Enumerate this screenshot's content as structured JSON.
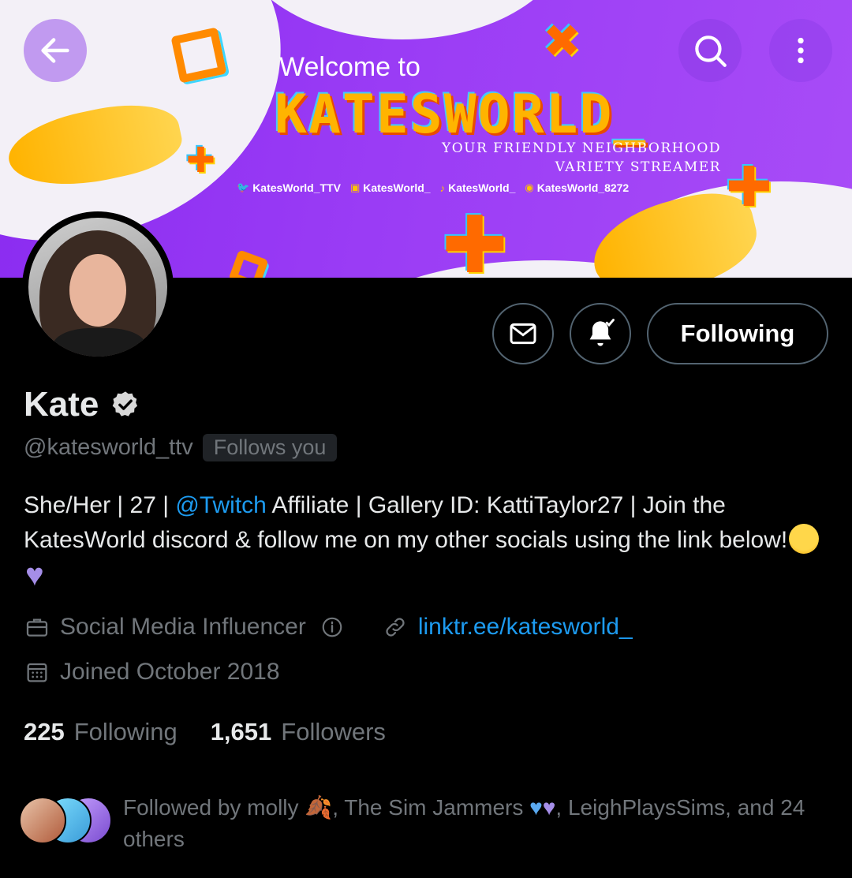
{
  "banner": {
    "welcome": "Welcome to",
    "title": "KATESWORLD_",
    "tagline_line1": "YOUR FRIENDLY NEIGHBORHOOD",
    "tagline_line2": "VARIETY STREAMER",
    "socials": [
      {
        "icon": "twitter-icon",
        "label": "KatesWorld_TTV"
      },
      {
        "icon": "twitch-icon",
        "label": "KatesWorld_"
      },
      {
        "icon": "tiktok-icon",
        "label": "KatesWorld_"
      },
      {
        "icon": "discord-icon",
        "label": "KatesWorld_8272"
      }
    ]
  },
  "actions": {
    "following_label": "Following"
  },
  "profile": {
    "name": "Kate",
    "handle": "@katesworld_ttv",
    "follows_you": "Follows you",
    "bio_part1": "She/Her | 27 | ",
    "bio_mention": "@Twitch",
    "bio_part2": " Affiliate | Gallery ID: KattiTaylor27 | Join the KatesWorld discord & follow me on my other socials using the link below!",
    "category": "Social Media Influencer",
    "link": "linktr.ee/katesworld_",
    "joined": "Joined October 2018"
  },
  "stats": {
    "following_count": "225",
    "following_label": "Following",
    "followers_count": "1,651",
    "followers_label": "Followers"
  },
  "followed_by": {
    "prefix": "Followed by molly ",
    "name2": ", The Sim Jammers ",
    "suffix": ", LeighPlaysSims, and 24 others"
  },
  "colors": {
    "accent_link": "#1d9bf0",
    "muted_text": "#71767b",
    "banner_purple": "#9a3cf5"
  }
}
